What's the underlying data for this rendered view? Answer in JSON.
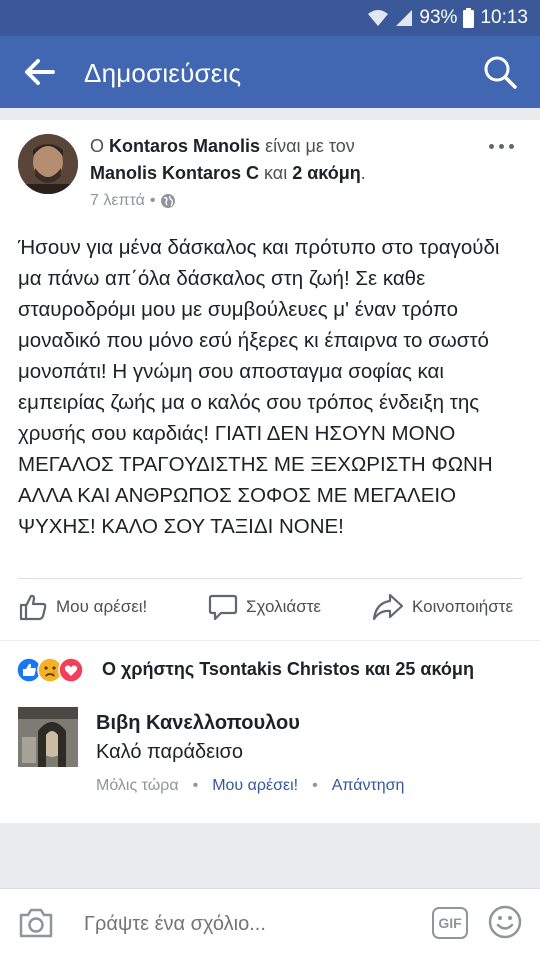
{
  "status_bar": {
    "battery": "93%",
    "time": "10:13"
  },
  "app_bar": {
    "title": "Δημοσιεύσεις"
  },
  "post": {
    "prefix": "Ο",
    "author": "Kontaros Manolis",
    "with_text": "είναι με τον",
    "tagged": "Manolis Kontaros C",
    "and_text": "και",
    "others": "2 ακόμη",
    "period": ".",
    "time": "7 λεπτά",
    "separator": "•",
    "audience_icon": "globe-icon",
    "text": "Ήσουν για μένα δάσκαλος και πρότυπο στο τραγούδι μα πάνω απ΄όλα δάσκαλος στη ζωή! Σε καθε σταυροδρόμι μου με συμβούλευες μ' έναν τρόπο μοναδικό που μόνο εσύ ήξερες κι έπαιρνα το σωστό μονοπάτι!  Η γνώμη σου αποσταγμα σοφίας και εμπειρίας ζωής μα ο καλός σου τρόπος ένδειξη της χρυσής σου καρδιάς! ΓΙΑΤΙ ΔΕΝ ΗΣΟΥΝ ΜΟΝΟ ΜΕΓΑΛΟΣ ΤΡΑΓΟΥΔΙΣΤΗΣ ΜΕ ΞΕΧΩΡΙΣΤΗ ΦΩΝΗ ΑΛΛΑ ΚΑΙ ΑΝΘΡΩΠΟΣ ΣΟΦΟΣ ΜΕ ΜΕΓΑΛΕΙΟ ΨΥΧΗΣ! ΚΑΛΟ ΣΟΥ ΤΑΞΙΔΙ ΝΟΝΕ!"
  },
  "actions": {
    "like": "Μου αρέσει!",
    "comment": "Σχολιάστε",
    "share": "Κοινοποιήστε"
  },
  "reactions": {
    "icons": [
      "like-icon",
      "sad-icon",
      "love-icon"
    ],
    "text": "Ο χρήστης Tsontakis Christos και 25 ακόμη"
  },
  "comment": {
    "author": "Βιβη Κανελλοπουλου",
    "text": "Καλό παράδεισο",
    "time": "Μόλις τώρα",
    "separator": "•",
    "like": "Μου αρέσει!",
    "reply": "Απάντηση"
  },
  "composer": {
    "placeholder": "Γράψτε ένα σχόλιο...",
    "gif_label": "GIF"
  },
  "colors": {
    "brand_blue": "#4267b2",
    "status_blue": "#3b5998",
    "link_blue": "#365899",
    "like_blue": "#1877f2",
    "love_red": "#f33e58",
    "sad_yellow": "#f7b125"
  }
}
